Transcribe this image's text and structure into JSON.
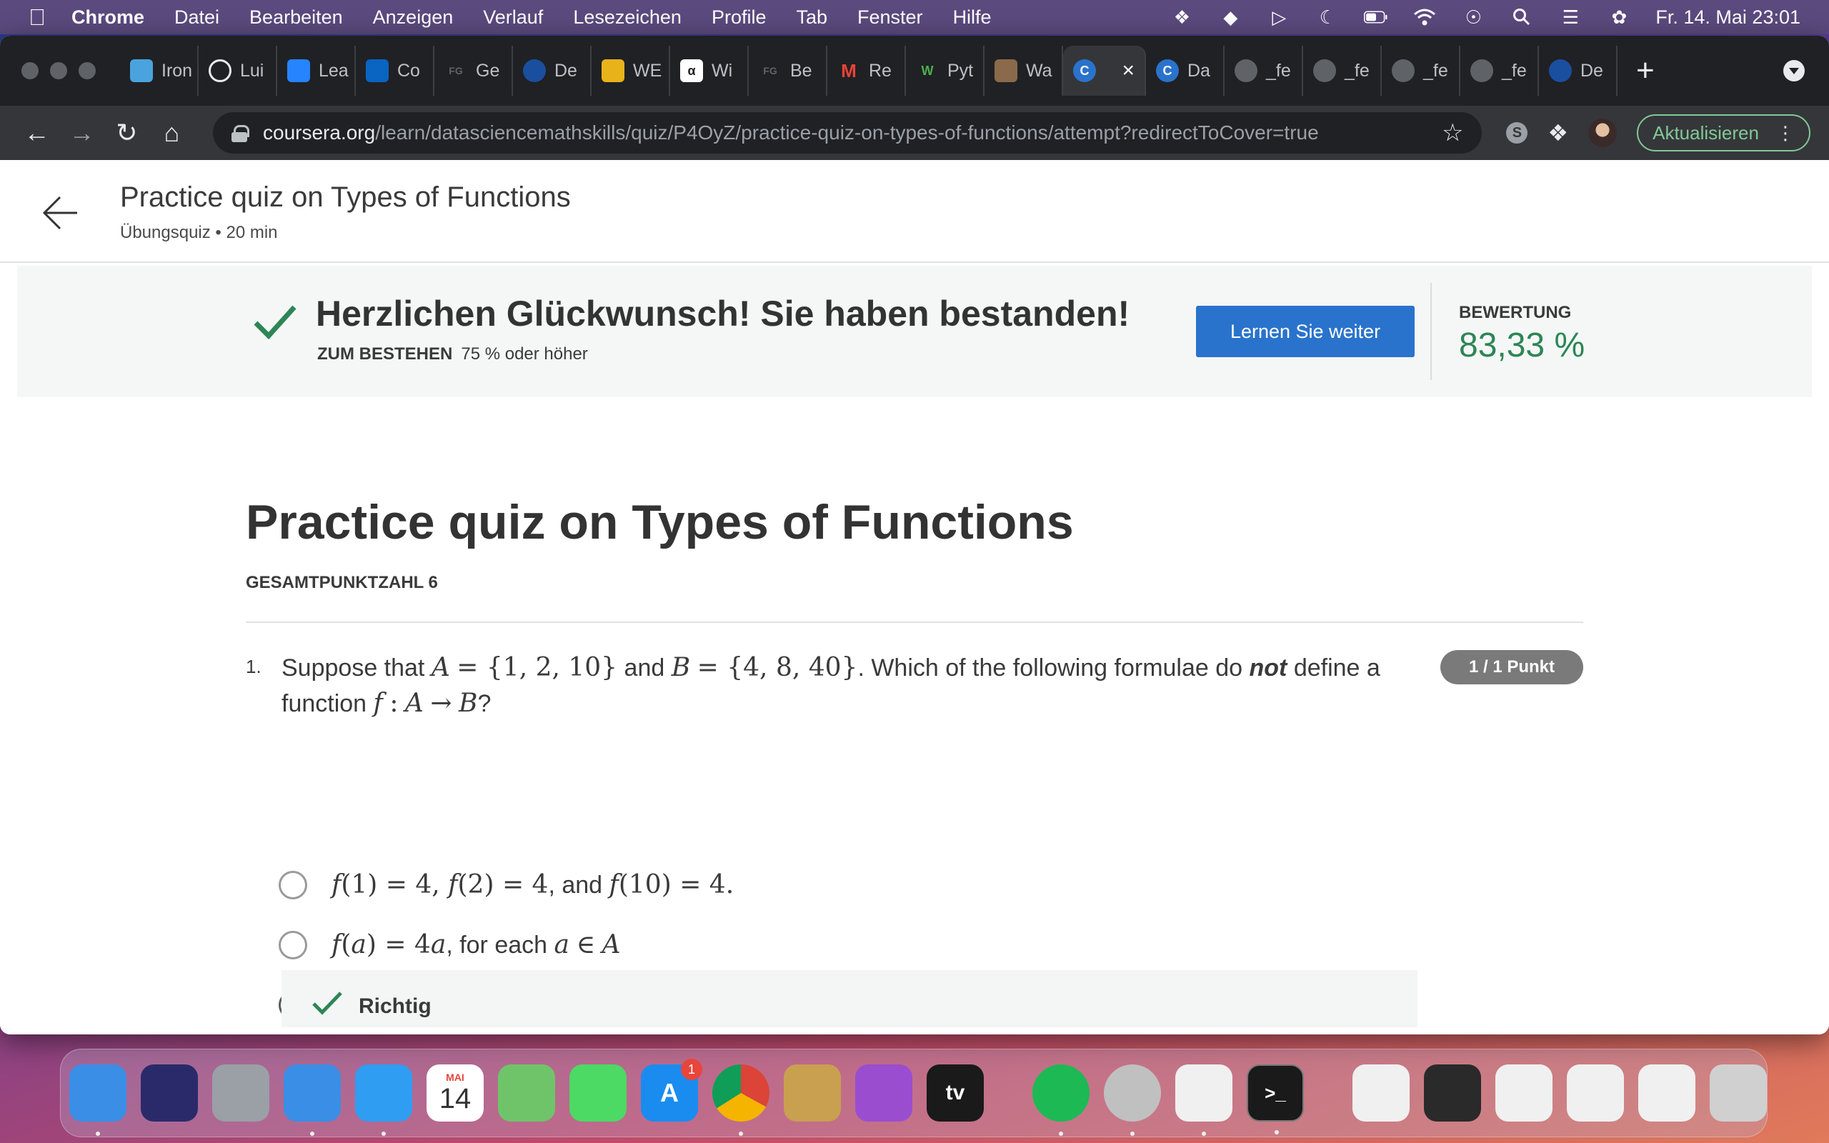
{
  "menubar": {
    "app": "Chrome",
    "items": [
      "Datei",
      "Bearbeiten",
      "Anzeigen",
      "Verlauf",
      "Lesezeichen",
      "Profile",
      "Tab",
      "Fenster",
      "Hilfe"
    ],
    "clock": "Fr. 14. Mai  23:01"
  },
  "tabs": [
    {
      "label": "Iron",
      "icon": "app-icon",
      "color": "#4aa3df"
    },
    {
      "label": "Lui",
      "icon": "github-icon",
      "color": "#202124"
    },
    {
      "label": "Lea",
      "icon": "atlassian-icon",
      "color": "#2684ff"
    },
    {
      "label": "Co",
      "icon": "outlook-icon",
      "color": "#0a64c2"
    },
    {
      "label": "Ge",
      "icon": "fg-icon",
      "color": "#5f6368"
    },
    {
      "label": "De",
      "icon": "globe-icon",
      "color": "#1a4fa0"
    },
    {
      "label": "WE",
      "icon": "bank-icon",
      "color": "#e8b21a"
    },
    {
      "label": "Wi",
      "icon": "wolfram-icon",
      "color": "#ffffff"
    },
    {
      "label": "Be",
      "icon": "fg-icon",
      "color": "#5f6368"
    },
    {
      "label": "Re",
      "icon": "gmail-icon",
      "color": "#ea4335"
    },
    {
      "label": "Pyt",
      "icon": "w3-icon",
      "color": "#4caf50"
    },
    {
      "label": "Wa",
      "icon": "image-icon",
      "color": "#8a6a4a"
    },
    {
      "label": "C",
      "icon": "coursera-icon",
      "color": "#2a73cc",
      "active": true
    },
    {
      "label": "Da",
      "icon": "coursera-icon",
      "color": "#2a73cc"
    },
    {
      "label": "_fe",
      "icon": "globe-icon",
      "color": "#5f6368"
    },
    {
      "label": "_fe",
      "icon": "globe-icon",
      "color": "#5f6368"
    },
    {
      "label": "_fe",
      "icon": "globe-icon",
      "color": "#5f6368"
    },
    {
      "label": "_fe",
      "icon": "globe-icon",
      "color": "#5f6368"
    },
    {
      "label": "De",
      "icon": "globe-icon",
      "color": "#1a4fa0"
    }
  ],
  "toolbar": {
    "url_host": "coursera.org",
    "url_path": "/learn/datasciencemathskills/quiz/P4OyZ/practice-quiz-on-types-of-functions/attempt?redirectToCover=true",
    "update_label": "Aktualisieren"
  },
  "header": {
    "title": "Practice quiz on Types of Functions",
    "subtitle": "Übungsquiz • 20 min"
  },
  "banner": {
    "title": "Herzlichen Glückwunsch! Sie haben bestanden!",
    "pass_label": "ZUM BESTEHEN",
    "pass_value": "75 % oder höher",
    "continue_label": "Lernen Sie weiter",
    "grade_label": "BEWERTUNG",
    "grade_value": "83,33 %",
    "accent_color": "#2e8556",
    "button_color": "#2a73cc"
  },
  "quiz": {
    "title": "Practice quiz on Types of Functions",
    "total_points": "GESAMTPUNKTZAHL 6",
    "question": {
      "number": "1.",
      "points": "1 / 1 Punkt",
      "selected_option_index": 2,
      "feedback": "Richtig"
    }
  },
  "dock": {
    "apps": [
      {
        "name": "finder-icon",
        "color": "#3a8ee6"
      },
      {
        "name": "siri-icon",
        "color": "#2a2a6a"
      },
      {
        "name": "launchpad-icon",
        "color": "#9aa0a6"
      },
      {
        "name": "mail-icon",
        "color": "#3a8ee6"
      },
      {
        "name": "safari-icon",
        "color": "#2f9df2"
      },
      {
        "name": "calendar-icon",
        "color": "#ffffff"
      },
      {
        "name": "maps-icon",
        "color": "#6fc46a"
      },
      {
        "name": "messages-icon",
        "color": "#4cd964"
      },
      {
        "name": "app-store-icon",
        "color": "#1a8cf0"
      },
      {
        "name": "chrome-icon",
        "color": "#ffffff"
      },
      {
        "name": "archive-utility-icon",
        "color": "#c8a050"
      },
      {
        "name": "podcasts-icon",
        "color": "#9b4dd0"
      },
      {
        "name": "apple-tv-icon",
        "color": "#1a1a1a"
      },
      {
        "name": "spotify-icon",
        "color": "#1db954"
      },
      {
        "name": "disk-utility-icon",
        "color": "#c0c0c0"
      },
      {
        "name": "numbers-icon",
        "color": "#f0f0f0"
      },
      {
        "name": "terminal-icon",
        "color": "#1a1a1a"
      },
      {
        "name": "document-icon",
        "color": "#f0f0f0"
      },
      {
        "name": "screenshot-icon",
        "color": "#2a2a2a"
      },
      {
        "name": "screenshot-icon",
        "color": "#f0f0f0"
      },
      {
        "name": "screenshot-icon",
        "color": "#f0f0f0"
      },
      {
        "name": "screenshot-icon",
        "color": "#f0f0f0"
      },
      {
        "name": "trash-icon",
        "color": "#d0d0d0"
      }
    ],
    "calendar_month": "MAI",
    "calendar_day": "14",
    "appstore_badge": "1"
  }
}
